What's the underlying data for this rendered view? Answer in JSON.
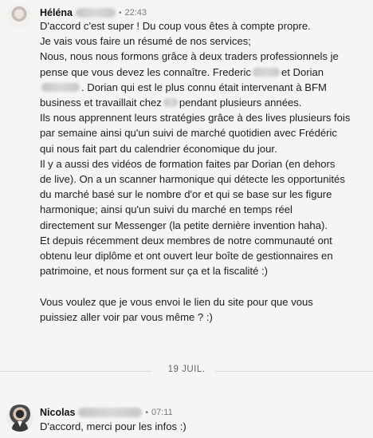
{
  "messages": [
    {
      "sender_name": "Héléna",
      "time": "22:43",
      "separator": "•",
      "body_lines": [
        "D'accord c'est super ! Du coup vous êtes à compte propre.",
        "Je vais vous faire un résumé de nos services;",
        "Nous, nous nous formons grâce à deux traders professionnels je",
        "pense que vous devez les connaître. Frederic",
        "et Dorian",
        "Dorian qui est le plus connu était intervenant à BFM",
        "business et travaillait chez",
        "pendant plusieurs années.",
        "Ils nous apprennent leurs stratégies grâce à des lives plusieurs fois",
        "par semaine ainsi qu'un suivi de marché quotidien avec Frédéric",
        "qui nous fait part du calendrier économique du jour.",
        "Il y a aussi des vidéos de formation faites par Dorian (en dehors",
        "de live). On a un scanner harmonique qui détecte les opportunités",
        "du marché basé sur le nombre d'or et qui se base sur les figure",
        "harmonique; ainsi qu'un suivi du marché en temps réel",
        "directement sur Messenger (la petite dernière invention haha).",
        "Et depuis récemment deux membres de notre communauté ont",
        "obtenu leur diplôme et ont ouvert leur boîte de gestionnaires en",
        "patrimoine, et nous forment sur ça et la fiscalité :)",
        "",
        "Vous voulez que je vous envoi le lien du site pour que vous",
        "puissiez aller voir par vous même ? :)"
      ]
    },
    {
      "sender_name": "Nicolas",
      "time": "07:11",
      "separator": "•",
      "body_lines": [
        "D'accord, merci pour les infos :)"
      ]
    }
  ],
  "date_divider": "19 JUIL."
}
